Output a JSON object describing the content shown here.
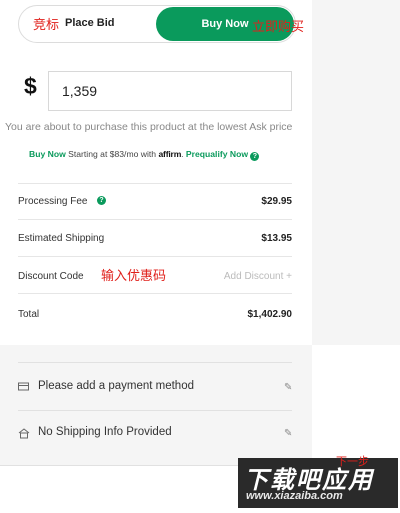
{
  "toggle": {
    "place_bid_label": "Place Bid",
    "buy_now_label": "Buy Now",
    "annotation_place_bid": "竞标",
    "annotation_buy_now": "立即购买"
  },
  "price": {
    "currency_symbol": "$",
    "value": "1,359"
  },
  "notice": "You are about to purchase this product at the lowest Ask price",
  "affirm": {
    "buy_now": "Buy Now",
    "starting_at": "Starting at $83/mo with",
    "logo": "affirm",
    "prequalify": "Prequalify Now",
    "help_glyph": "?"
  },
  "fees": {
    "processing_label": "Processing Fee",
    "processing_help": "?",
    "processing_value": "$29.95",
    "shipping_label": "Estimated Shipping",
    "shipping_value": "$13.95",
    "discount_label": "Discount Code",
    "discount_annotation": "输入优惠码",
    "discount_placeholder": "Add Discount +",
    "total_label": "Total",
    "total_value": "$1,402.90"
  },
  "payment": {
    "payment_text": "Please add a payment method",
    "shipping_text": "No Shipping Info Provided",
    "edit_glyph": "✎"
  },
  "watermark": {
    "big": "下载吧应用",
    "url": "www.xiazaiba.com",
    "small": "下一步"
  },
  "colors": {
    "accent_green": "#0a9a5c",
    "annotation_red": "#e0201b"
  }
}
